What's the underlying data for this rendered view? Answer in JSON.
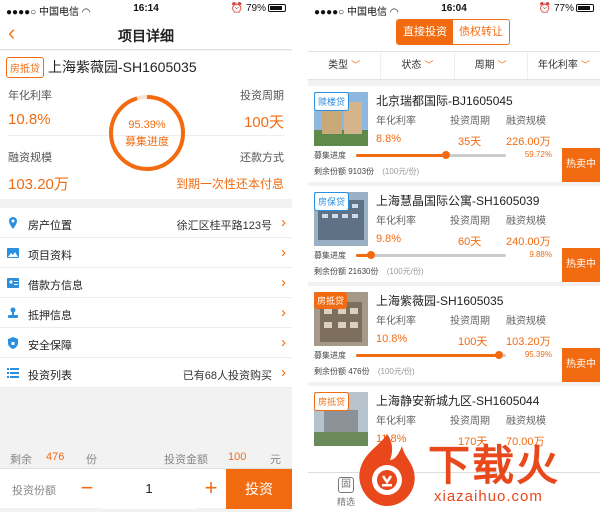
{
  "left": {
    "status": {
      "carrier": "中国电信",
      "time": "16:14",
      "battery": "79%"
    },
    "nav_title": "项目详细",
    "tag": "房抵贷",
    "project_name": "上海紫薇园-SH1605035",
    "annual_rate": {
      "label": "年化利率",
      "value": "10.8%"
    },
    "period": {
      "label": "投资周期",
      "value": "100天"
    },
    "scale": {
      "label": "融资规模",
      "value": "103.20万"
    },
    "repay": {
      "label": "还款方式",
      "value": "到期一次性还本付息"
    },
    "progress": {
      "value": "95.39%",
      "label": "募集进度",
      "fraction": 0.9539
    },
    "menu": [
      {
        "label": "房产位置",
        "value": "徐汇区桂平路123号",
        "icon": "location-pin-icon"
      },
      {
        "label": "项目资料",
        "value": "",
        "icon": "image-icon"
      },
      {
        "label": "借款方信息",
        "value": "",
        "icon": "id-card-icon"
      },
      {
        "label": "抵押信息",
        "value": "",
        "icon": "stamp-icon"
      },
      {
        "label": "安全保障",
        "value": "",
        "icon": "shield-icon"
      },
      {
        "label": "投资列表",
        "value": "已有68人投资购买",
        "icon": "list-icon"
      }
    ],
    "remain": {
      "label": "剩余",
      "value": "476",
      "unit": "份",
      "amount_label": "投资金额",
      "amount": "100",
      "amount_unit": "元"
    },
    "buy": {
      "label": "投资份额",
      "qty": "1",
      "minus": "−",
      "plus": "+",
      "button": "投资"
    }
  },
  "right": {
    "status": {
      "carrier": "中国电信",
      "time": "16:04",
      "battery": "77%"
    },
    "segments": [
      "直接投资",
      "债权转让"
    ],
    "filters": [
      "类型",
      "状态",
      "周期",
      "年化利率"
    ],
    "col_labels": {
      "rate": "年化利率",
      "period": "投资周期",
      "scale": "融资规模",
      "progress": "募集进度",
      "remain": "剩余份额",
      "unit": "(100元/份)"
    },
    "cards": [
      {
        "tag": "赎楼贷",
        "tag_style": "blue",
        "name": "北京瑞都国际-BJ1605045",
        "rate": "8.8%",
        "period": "35天",
        "scale": "226.00万",
        "pct": "59.72%",
        "fraction": 0.5972,
        "remain": "9103份",
        "hot": "热卖中"
      },
      {
        "tag": "房保贷",
        "tag_style": "blue",
        "name": "上海慧晶国际公寓-SH1605039",
        "rate": "9.8%",
        "period": "60天",
        "scale": "240.00万",
        "pct": "9.88%",
        "fraction": 0.0988,
        "remain": "21630份",
        "hot": "热卖中"
      },
      {
        "tag": "房抵贷",
        "tag_style": "orange",
        "name": "上海紫薇园-SH1605035",
        "rate": "10.8%",
        "period": "100天",
        "scale": "103.20万",
        "pct": "95.39%",
        "fraction": 0.9539,
        "remain": "476份",
        "hot": "热卖中"
      },
      {
        "tag": "房抵贷",
        "tag_style": "outline",
        "name": "上海静安新城九区-SH1605044",
        "rate": "11.8%",
        "period": "170天",
        "scale": "70.00万",
        "pct": "",
        "fraction": 0,
        "remain": "",
        "hot": ""
      }
    ],
    "tab_label": "精选",
    "tab_glyph": "固"
  },
  "watermark": {
    "title": "下载火",
    "url": "xiazaihuo.com"
  },
  "colors": {
    "accent": "#f26b11",
    "blue": "#2b8fe0"
  }
}
